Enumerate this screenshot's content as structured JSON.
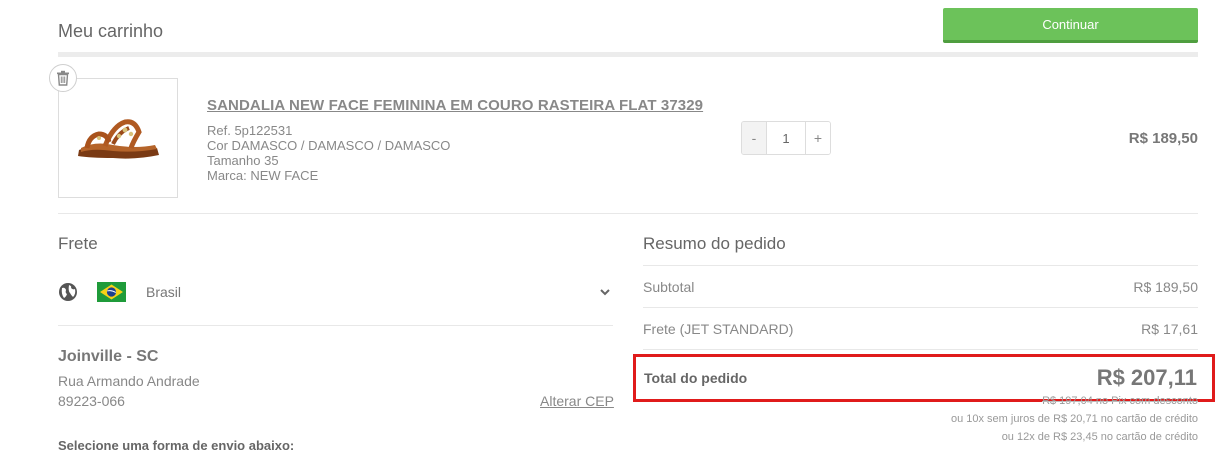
{
  "header": {
    "title": "Meu carrinho",
    "continue_label": "Continuar"
  },
  "cart": {
    "item": {
      "name": "SANDALIA NEW FACE FEMININA EM COURO RASTEIRA FLAT 37329",
      "ref": "Ref. 5p122531",
      "color": "Cor DAMASCO / DAMASCO / DAMASCO",
      "size": "Tamanho 35",
      "brand": "Marca: NEW FACE",
      "quantity": "1",
      "qty_minus": "-",
      "qty_plus": "+",
      "price": "R$ 189,50"
    }
  },
  "shipping": {
    "title": "Frete",
    "country": "Brasil",
    "city": "Joinville - SC",
    "street": "Rua Armando Andrade",
    "cep": "89223-066",
    "change_cep": "Alterar CEP",
    "select_prompt": "Selecione uma forma de envio abaixo:"
  },
  "summary": {
    "title": "Resumo do pedido",
    "subtotal_label": "Subtotal",
    "subtotal_value": "R$ 189,50",
    "shipping_label": "Frete (JET STANDARD)",
    "shipping_value": "R$ 17,61",
    "total_label": "Total do pedido",
    "total_value": "R$ 207,11",
    "pix_line": "R$ 197,04 no Pix com desconto",
    "installments_10": "ou 10x sem juros de R$ 20,71 no cartão de crédito",
    "installments_12": "ou 12x de R$ 23,45 no cartão de crédito"
  },
  "colors": {
    "accent_green": "#6cc25a",
    "highlight_red": "#e01b1b",
    "flag_green": "#1f9b3a"
  },
  "icons": [
    "trash-icon",
    "globe-icon",
    "brazil-flag-icon",
    "chevron-down-icon"
  ]
}
